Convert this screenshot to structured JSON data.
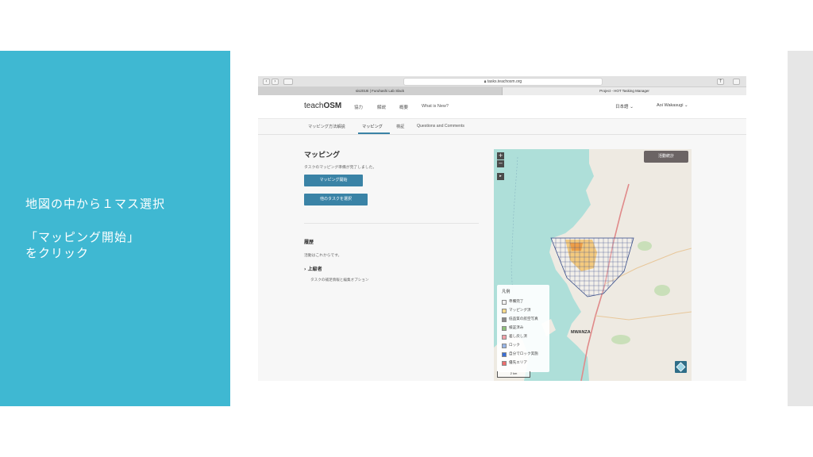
{
  "slide": {
    "instruction_line1": "地図の中から１マス選択",
    "instruction_line2": "「マッピング開始」",
    "instruction_line3": "をクリック"
  },
  "browser": {
    "url": "tasks.teachosm.org",
    "tabs": [
      {
        "label": "sis2019i | Furuhashi Lab Slack"
      },
      {
        "label": "Project - HOT Tasking Manager"
      }
    ]
  },
  "header": {
    "logo_prefix": "teach",
    "logo_suffix": "OSM",
    "nav": [
      "協力",
      "解説",
      "概要",
      "What is New?"
    ],
    "language": "日本語",
    "user": "Aoi Wakasugi"
  },
  "sub_tabs": [
    "マッピング方法解説",
    "マッピング",
    "検証",
    "Questions and Comments"
  ],
  "task_panel": {
    "title": "マッピング",
    "status": "タスクのマッピング準備が完了しました。",
    "start_button": "マッピング開始",
    "select_other_button": "他のタスクを選択",
    "history_title": "履歴",
    "history_text": "活動はこれからです。",
    "advanced_title": "上級者",
    "advanced_desc": "タスクの補足情報と編集オプション"
  },
  "map": {
    "zoom_in": "+",
    "zoom_out": "−",
    "stats_button": "活動統計",
    "city_label": "MWANZA",
    "scale_label": "2 km",
    "legend": {
      "title": "凡例",
      "items": [
        {
          "label": "準備完了",
          "color": "#f2f2f2"
        },
        {
          "label": "マッピング済",
          "color": "#f6d98a"
        },
        {
          "label": "低品質の航空写真",
          "color": "#8a8a8a"
        },
        {
          "label": "検証済み",
          "color": "#8cc07a"
        },
        {
          "label": "差し戻し済",
          "color": "#f1a0a8"
        },
        {
          "label": "ロック",
          "color": "#98b5e8"
        },
        {
          "label": "自分でロック実施",
          "color": "#3a6fd8"
        },
        {
          "label": "優先エリア",
          "color": "#ee6e6e"
        }
      ]
    }
  },
  "colors": {
    "accent": "#3fb8d2",
    "primary_button": "#3a83a6",
    "stats_button": "#6b6464"
  }
}
